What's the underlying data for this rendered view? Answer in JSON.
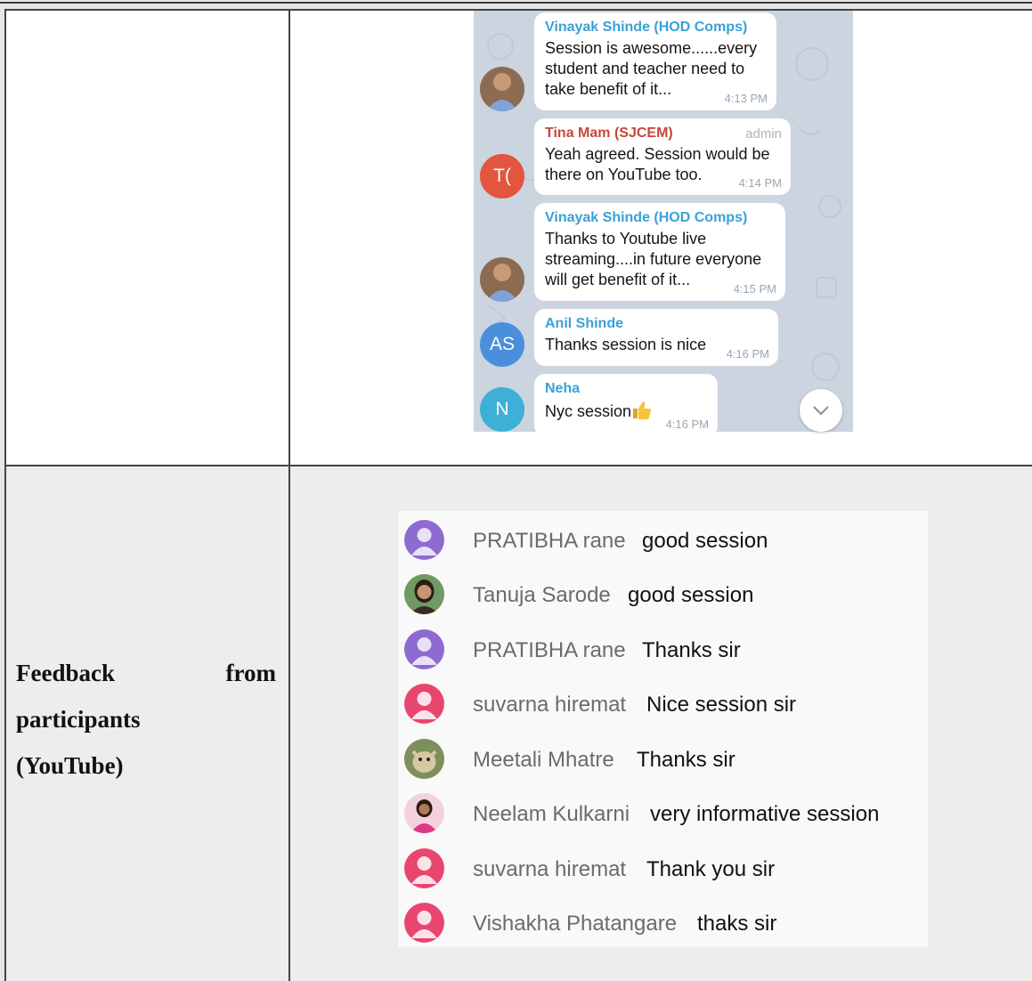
{
  "table": {
    "row_label_line1_left": "Feedback",
    "row_label_line1_right": "from",
    "row_label_line2": "participants",
    "row_label_line3": "(YouTube)"
  },
  "telegram_chat": {
    "messages": [
      {
        "sender": "Vinayak Shinde (HOD Comps)",
        "role": "",
        "lines": [
          "Session is awesome......every",
          "student and teacher need to",
          "take benefit of it..."
        ],
        "time": "4:13 PM",
        "avatar": "photo",
        "avatar_initials": ""
      },
      {
        "sender": "Tina Mam (SJCEM)",
        "role": "admin",
        "lines": [
          "Yeah agreed. Session would be",
          "there on YouTube too."
        ],
        "time": "4:14 PM",
        "avatar": "initials",
        "avatar_initials": "T("
      },
      {
        "sender": "Vinayak Shinde (HOD Comps)",
        "role": "",
        "lines": [
          "Thanks to Youtube live",
          "streaming....in future everyone",
          "will get benefit of it..."
        ],
        "time": "4:15 PM",
        "avatar": "photo",
        "avatar_initials": ""
      },
      {
        "sender": "Anil Shinde",
        "role": "",
        "lines": [
          "Thanks session is nice"
        ],
        "time": "4:16 PM",
        "avatar": "initials",
        "avatar_initials": "AS"
      },
      {
        "sender": "Neha",
        "role": "",
        "lines": [
          "Nyc session"
        ],
        "time": "4:16 PM",
        "avatar": "initials",
        "avatar_initials": "N"
      }
    ],
    "icons": {
      "reaction": "thumbs-up-icon",
      "scroll": "chevron-down-icon"
    },
    "colors": {
      "tina": "#e2553f",
      "anil": "#4a8fdc",
      "neha": "#3cb0d6",
      "tina_name": "#c6463a",
      "sender": "#3aa0d6"
    }
  },
  "youtube_comments": [
    {
      "name": "PRATIBHA rane",
      "text": "good session",
      "avatar": "default-purple"
    },
    {
      "name": "Tanuja Sarode",
      "text": "good session",
      "avatar": "photo"
    },
    {
      "name": "PRATIBHA rane",
      "text": "Thanks sir",
      "avatar": "default-purple"
    },
    {
      "name": "suvarna hiremat",
      "text": "Nice session sir",
      "avatar": "default-pink"
    },
    {
      "name": "Meetali Mhatre",
      "text": "Thanks sir",
      "avatar": "photo"
    },
    {
      "name": "Neelam Kulkarni",
      "text": "very informative session",
      "avatar": "photo"
    },
    {
      "name": "suvarna hiremat",
      "text": "Thank you sir",
      "avatar": "default-pink"
    },
    {
      "name": "Vishakha Phatangare",
      "text": "thaks sir",
      "avatar": "default-pink"
    }
  ]
}
